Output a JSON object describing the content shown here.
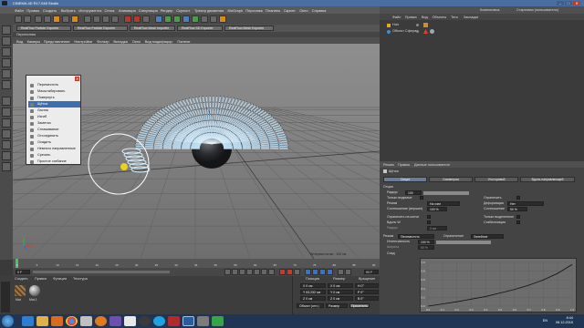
{
  "window": {
    "title": "CINEMA 4D R17.048 Studio (RC - R17) - [Без имени] - Основной",
    "title_short": "CINEMA 4D R17.048 Studio",
    "min": "–",
    "max": "□",
    "close": "✕"
  },
  "menubar": [
    "Файл",
    "Правка",
    "Создать",
    "Выбрать",
    "Инструменты",
    "Сетка",
    "Анимация",
    "Симуляция",
    "Рендер",
    "Скульпт",
    "Трекер движения",
    "MoGraph",
    "Персонаж",
    "Плагины",
    "Скрипт",
    "Окно",
    "Справка"
  ],
  "layout": {
    "label": "Компоновка:",
    "value": "Стартовая (пользователь)"
  },
  "plugin_tabs": [
    "RealFlow Particle Exporter",
    "RealFlow Particle Exporter",
    "RealFlow Mesh Importer",
    "RealFlow SD Exporter",
    "RealFlow Mesh Exporter"
  ],
  "viewport": {
    "header": "Перспектива",
    "menu": [
      "Вид",
      "Камеры",
      "Представление",
      "Настройки",
      "Фильтр",
      "Вкладка",
      "Окно",
      "Вид модифицир.",
      "Панели"
    ],
    "grid_info": "Интервал сетки : 100 см",
    "axis_x": "X",
    "axis_y": "Y",
    "axis_z": "Z"
  },
  "context_menu": {
    "close": "✕",
    "items": [
      "Переместить",
      "Масштабировать",
      "Повернуть",
      "Щётка",
      "Ластик",
      "Изгиб",
      "Заметка",
      "Сглаживание",
      "Отсоединить",
      "Осадить",
      "Немного направленные",
      "Срезать",
      "Простое сгибание"
    ],
    "selected_index": 3
  },
  "timeline": {
    "ticks": [
      "0",
      "5",
      "10",
      "15",
      "20",
      "25",
      "30",
      "35",
      "40",
      "45",
      "50",
      "55",
      "60",
      "65",
      "70",
      "75",
      "80",
      "85",
      "90"
    ],
    "current_frame": "0 F",
    "end_frame": "90 F"
  },
  "material_panel": {
    "tabs": [
      "Создать",
      "Правка",
      "Функция",
      "Текстура"
    ],
    "materials": [
      "Mat",
      "Mat.1"
    ]
  },
  "coord_panel": {
    "headers": [
      "Позиция",
      "Размер",
      "Вращение"
    ],
    "rows": [
      [
        "X  0 см",
        "X  0 см",
        "H  0°"
      ],
      [
        "Y  53.232 см",
        "Y  0 см",
        "P  0°"
      ],
      [
        "Z  0 см",
        "Z  0 см",
        "B  0°"
      ]
    ],
    "mode": "Объект (отн.)",
    "mode2": "Размер",
    "apply": "Применить"
  },
  "object_manager": {
    "tabs": [
      "Файл",
      "Правка",
      "Вид",
      "Объекты",
      "Теги",
      "Закладки"
    ],
    "objects": [
      {
        "name": "Hair",
        "color": "#e3a82a"
      },
      {
        "name": "Объект Сфера",
        "color": "#3f8fd6"
      }
    ]
  },
  "attr_manager": {
    "menu": [
      "Режим",
      "Правка",
      "Данные пользователя"
    ],
    "tool_name": "Щётка",
    "subtabs": [
      "Опции",
      "Симметрия",
      "Угол кривой",
      "Вдоль направляющей"
    ],
    "active_subtab": 0,
    "section": "Опции",
    "labels": {
      "radius": "Радиус",
      "only_visible": "Только видимые",
      "mode": "Режим",
      "ratio": "Соотношение (вершин)",
      "fix_root": "Ограничить",
      "guides": "Деформация",
      "reference": "Соотношение",
      "falloff_left": "Ограничить на кончи",
      "falloff_right": "Только выделенное",
      "vertex": "Вдоль W",
      "strength_left": "Радиус",
      "stiff": "Стабилизация",
      "mode2": "Режим",
      "falloff_label": "Ограничение",
      "intensity": "Интенсивность",
      "width": "Ширина",
      "graph_label": "Спад"
    },
    "values": {
      "radius": "100",
      "mode_value": "Перемещать",
      "fixed": "На узел",
      "deform_value": "Нет",
      "ratio": "100 %",
      "reference": "50 %",
      "strength": "0 см",
      "mode2_value": "Переместить",
      "falloff_value": "Линейное",
      "intensity": "100 %",
      "width": "50 %"
    },
    "graph_ticks": [
      "0.0",
      "0.1",
      "0.2",
      "0.3",
      "0.4",
      "0.5",
      "0.6",
      "0.7",
      "0.8",
      "0.9",
      "1.0"
    ],
    "graph_yticks": [
      "1.0",
      "0.8",
      "0.6",
      "0.4",
      "0.2",
      "0.0"
    ],
    "graph_curve": {
      "type": "line",
      "x": [
        0,
        0.1,
        0.2,
        0.3,
        0.4,
        0.5,
        0.6,
        0.7,
        0.8,
        0.9,
        1.0
      ],
      "y": [
        0,
        0.05,
        0.1,
        0.16,
        0.22,
        0.3,
        0.38,
        0.48,
        0.6,
        0.75,
        0.95
      ]
    }
  },
  "taskbar": {
    "lang": "EN",
    "time": "8:44",
    "date": "08.12.2015",
    "apps": [
      "start",
      "ie",
      "explorer",
      "media",
      "chrome",
      "firefox",
      "skype",
      "c4d",
      "app8",
      "app9",
      "app10",
      "app11"
    ]
  }
}
